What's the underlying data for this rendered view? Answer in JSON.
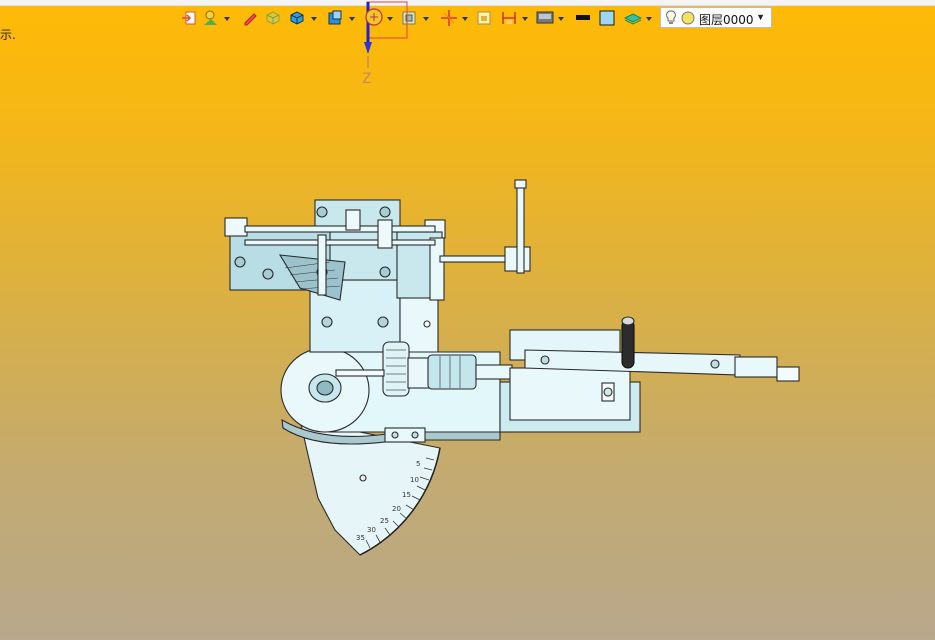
{
  "toolbar": {
    "icons": [
      "exit-icon",
      "light-icon",
      "pen-icon",
      "solid-icon",
      "box-icon",
      "view-cube-icon",
      "orient-icon",
      "section-icon",
      "axis-icon",
      "frame-icon",
      "dimension-icon",
      "display-icon",
      "black-line-icon",
      "blue-square-icon",
      "layer-stack-icon",
      "bulb-icon",
      "yellow-dot-icon"
    ],
    "layer_name": "图层0000"
  },
  "status": {
    "text": "示."
  },
  "viewport": {
    "axis_label": "Z"
  },
  "colors": {
    "accent": "#ffba05",
    "background_bottom": "#b8a88c",
    "part_fill": "#d7f1f6",
    "part_stroke": "#2a2a2a"
  }
}
